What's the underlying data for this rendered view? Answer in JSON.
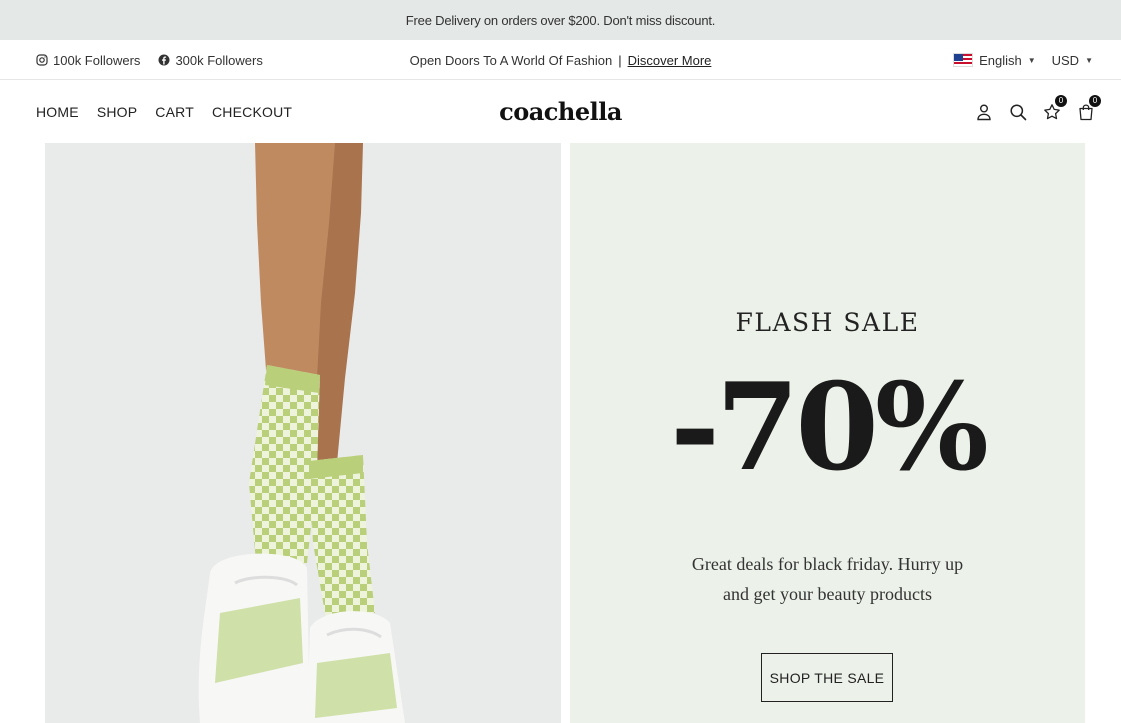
{
  "announcement": {
    "text": "Free Delivery on orders over $200. Don't miss discount."
  },
  "topbar": {
    "social": [
      {
        "icon": "instagram-icon",
        "label": "100k Followers"
      },
      {
        "icon": "facebook-icon",
        "label": "300k Followers"
      }
    ],
    "promo_text": "Open Doors To A World Of Fashion",
    "promo_separator": "|",
    "promo_link": "Discover More",
    "language": "English",
    "currency": "USD"
  },
  "header": {
    "nav": [
      "HOME",
      "SHOP",
      "CART",
      "CHECKOUT"
    ],
    "logo": "coachella",
    "wishlist_count": "0",
    "cart_count": "0"
  },
  "hero": {
    "title": "FLASH SALE",
    "discount": "-70%",
    "text": "Great deals for black friday. Hurry up and get your beauty products",
    "button": "SHOP THE SALE"
  },
  "colors": {
    "announcement_bg": "#e4e8e6",
    "sale_panel_bg": "#ecf2e9",
    "text_dark": "#1a1a1a"
  }
}
